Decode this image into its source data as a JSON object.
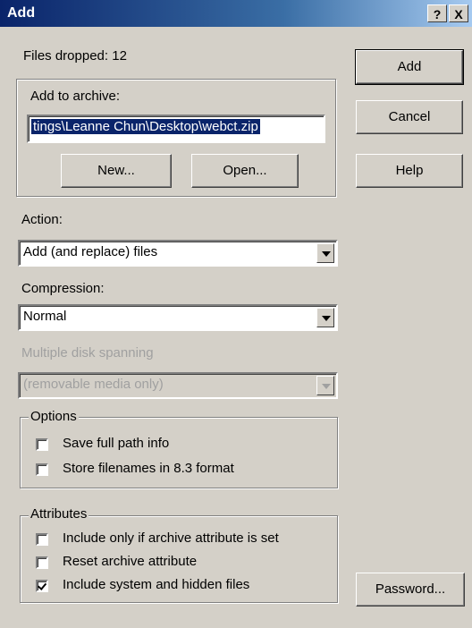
{
  "window": {
    "title": "Add",
    "help_button": "?",
    "close_button": "X"
  },
  "files_dropped": "Files dropped: 12",
  "archive_group": {
    "label": "Add to archive:",
    "path_value": "tings\\Leanne Chun\\Desktop\\webct.zip",
    "new_button": "New...",
    "open_button": "Open..."
  },
  "buttons": {
    "add": "Add",
    "cancel": "Cancel",
    "help": "Help",
    "password": "Password..."
  },
  "action": {
    "label": "Action:",
    "value": "Add (and replace) files"
  },
  "compression": {
    "label": "Compression:",
    "value": "Normal"
  },
  "spanning": {
    "label": "Multiple disk spanning",
    "value": "(removable media only)"
  },
  "options": {
    "label": "Options",
    "items": [
      {
        "label": "Save full path info",
        "checked": false
      },
      {
        "label": "Store filenames in 8.3 format",
        "checked": false
      }
    ]
  },
  "attributes": {
    "label": "Attributes",
    "items": [
      {
        "label": "Include only if archive attribute is set",
        "checked": false
      },
      {
        "label": "Reset archive attribute",
        "checked": false
      },
      {
        "label": "Include system and hidden files",
        "checked": true
      }
    ]
  }
}
